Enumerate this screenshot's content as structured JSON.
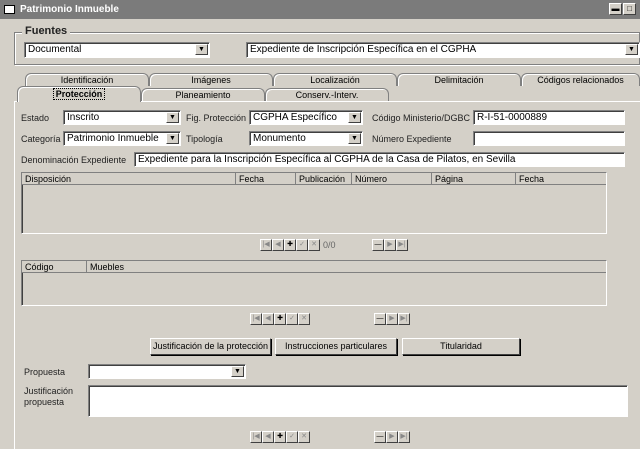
{
  "window": {
    "title": "Patrimonio Inmueble",
    "controls": [
      "▬",
      "□"
    ]
  },
  "fuentes": {
    "group_label": "Fuentes",
    "source_value": "Documental",
    "expediente_value": "Expediente de Inscripción Específica en el CGPHA"
  },
  "tabs": {
    "back": [
      "Identificación",
      "Imágenes",
      "Localización",
      "Delimitación",
      "Códigos relacionados"
    ],
    "front": [
      "Protección",
      "Planeamiento",
      "Conserv.-Interv."
    ],
    "active": "Protección"
  },
  "form": {
    "estado_label": "Estado",
    "estado_value": "Inscrito",
    "fig_label": "Fig. Protección",
    "fig_value": "CGPHA Específico",
    "codigo_label": "Código Ministerio/DGBC",
    "codigo_value": "R-I-51-0000889",
    "categoria_label": "Categoría",
    "categoria_value": "Patrimonio Inmueble",
    "tipologia_label": "Tipología",
    "tipologia_value": "Monumento",
    "numero_label": "Número Expediente",
    "numero_value": "",
    "denominacion_label": "Denominación Expediente",
    "denominacion_value": "Expediente para la Inscripción Específica al CGPHA de la Casa de Pilatos, en Sevilla"
  },
  "grid1": {
    "columns": [
      "Disposición",
      "Fecha",
      "Publicación",
      "Número",
      "Página",
      "Fecha"
    ],
    "record_count": "0/0"
  },
  "grid2": {
    "columns": [
      "Código",
      "Muebles"
    ]
  },
  "buttons": {
    "justificacion": "Justificación de la protección",
    "instrucciones": "Instrucciones particulares",
    "titularidad": "Titularidad"
  },
  "propuesta": {
    "label": "Propuesta",
    "value": "",
    "just_label_1": "Justificación",
    "just_label_2": "propuesta",
    "just_value": ""
  },
  "nav_glyphs": {
    "first": "|◀",
    "prev": "◀",
    "add": "✚",
    "save": "✓",
    "cancel": "✕",
    "del": "—",
    "next": "▶",
    "last": "▶|"
  }
}
